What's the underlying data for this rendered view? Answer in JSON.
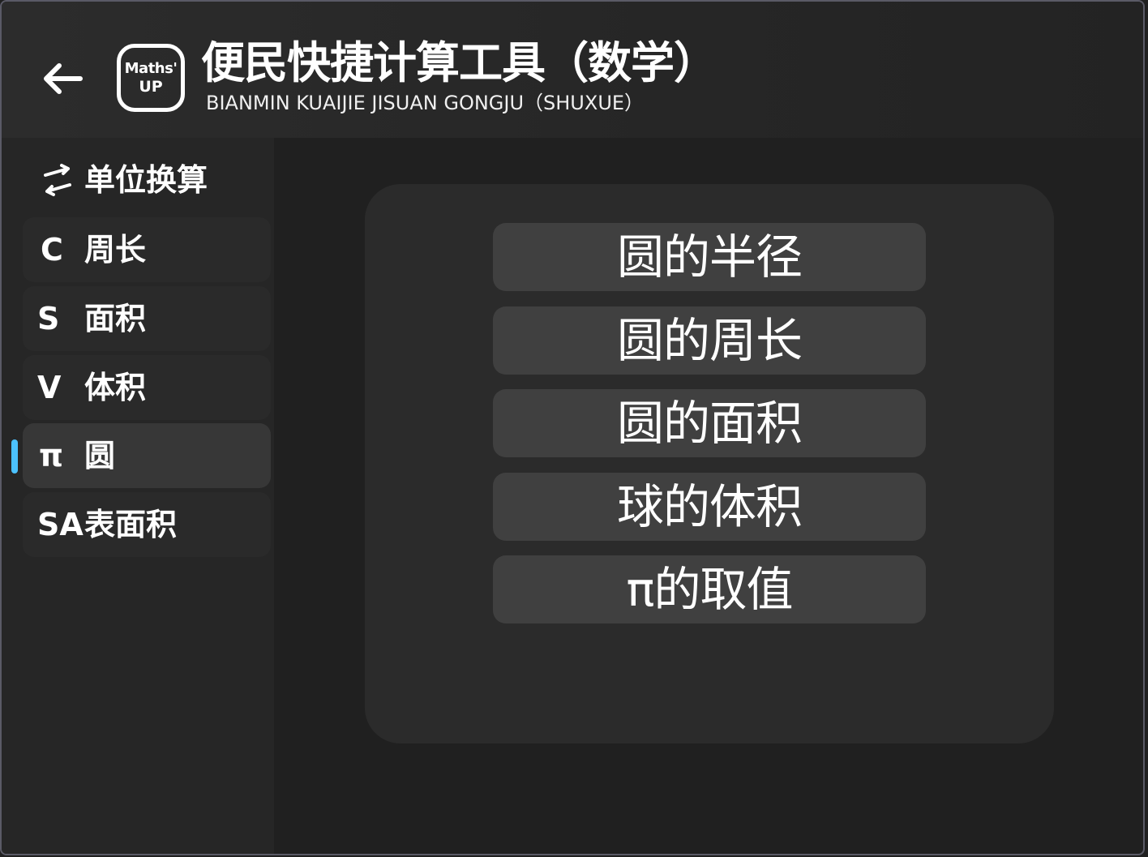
{
  "header": {
    "back_icon": "arrow-left-icon",
    "logo": {
      "line1": "Maths'",
      "line2": "UP"
    },
    "title": "便民快捷计算工具（数学）",
    "subtitle": "BIANMIN KUAIJIE JISUAN GONGJU（SHUXUE）"
  },
  "sidebar": {
    "accent_color": "#4cc2ff",
    "items": [
      {
        "icon": "⇄",
        "icon_name": "swap-arrows-icon",
        "label": "单位换算",
        "selected": false
      },
      {
        "icon": "C",
        "label": "周长",
        "selected": false
      },
      {
        "icon": "S",
        "label": "面积",
        "selected": false
      },
      {
        "icon": "V",
        "label": "体积",
        "selected": false
      },
      {
        "icon": "π",
        "label": "圆",
        "selected": true
      },
      {
        "icon": "SA",
        "label": "表面积",
        "selected": false
      }
    ]
  },
  "main": {
    "options": [
      {
        "label": "圆的半径"
      },
      {
        "label": "圆的周长"
      },
      {
        "label": "圆的面积"
      },
      {
        "label": "球的体积"
      },
      {
        "label": "π的取值"
      }
    ]
  }
}
